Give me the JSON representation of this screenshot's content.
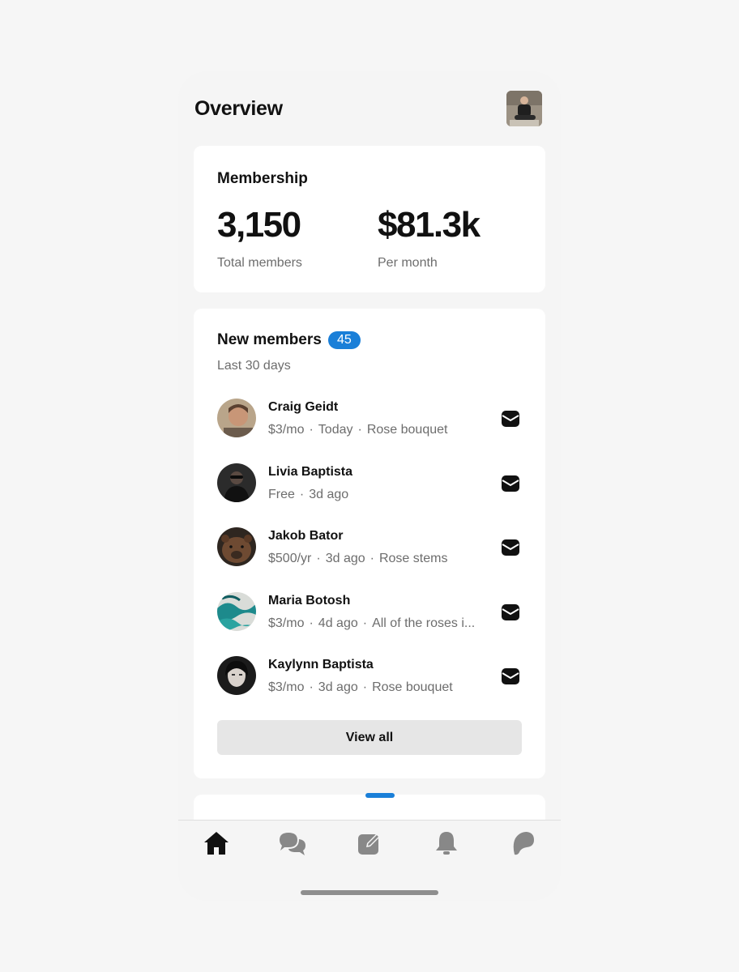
{
  "header": {
    "title": "Overview"
  },
  "membership": {
    "title": "Membership",
    "stats": [
      {
        "value": "3,150",
        "label": "Total members"
      },
      {
        "value": "$81.3k",
        "label": "Per month"
      }
    ]
  },
  "new_members": {
    "title": "New members",
    "count": "45",
    "subtitle": "Last 30 days",
    "members": [
      {
        "name": "Craig Geidt",
        "price": "$3/mo",
        "when": "Today",
        "tier": "Rose bouquet"
      },
      {
        "name": "Livia Baptista",
        "price": "Free",
        "when": "3d ago"
      },
      {
        "name": "Jakob Bator",
        "price": "$500/yr",
        "when": "3d ago",
        "tier": "Rose stems"
      },
      {
        "name": "Maria Botosh",
        "price": "$3/mo",
        "when": "4d ago",
        "tier": "All of the roses i..."
      },
      {
        "name": "Kaylynn Baptista",
        "price": "$3/mo",
        "when": "3d ago",
        "tier": "Rose bouquet"
      }
    ],
    "view_all_label": "View all"
  },
  "tabbar": {
    "tabs": [
      {
        "icon": "home-icon",
        "active": true
      },
      {
        "icon": "chat-icon",
        "active": false
      },
      {
        "icon": "compose-icon",
        "active": false
      },
      {
        "icon": "bell-icon",
        "active": false
      },
      {
        "icon": "patreon-icon",
        "active": false
      }
    ]
  },
  "colors": {
    "accent": "#1a7fd8",
    "background": "#f5f5f5",
    "card": "#ffffff",
    "muted_text": "#6d6d6d"
  }
}
